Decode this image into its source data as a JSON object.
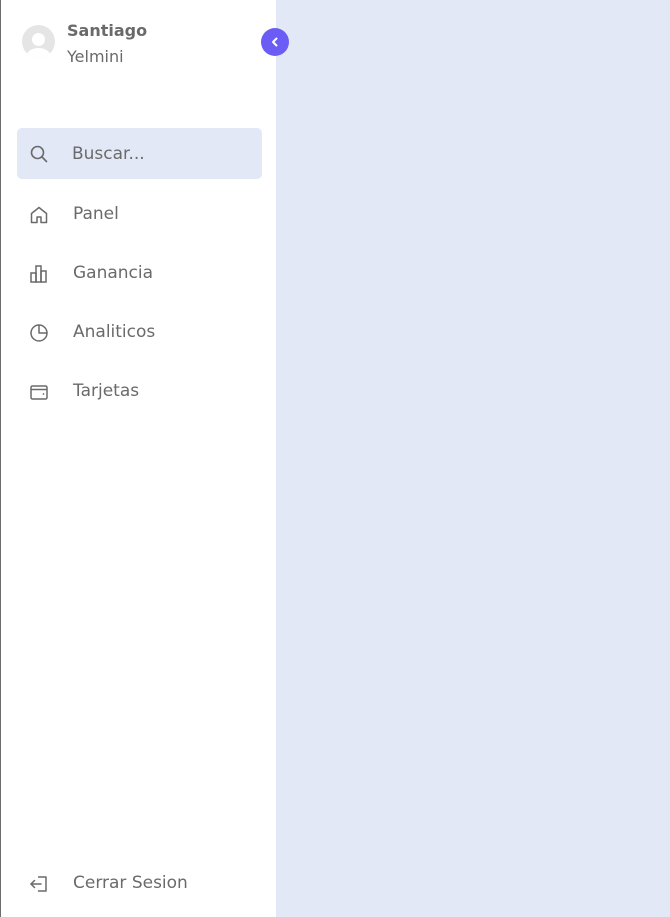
{
  "profile": {
    "first_name": "Santiago",
    "last_name": "Yelmini"
  },
  "search": {
    "placeholder": "Buscar..."
  },
  "nav": {
    "items": [
      {
        "label": "Panel",
        "icon": "home-icon"
      },
      {
        "label": "Ganancia",
        "icon": "bar-chart-icon"
      },
      {
        "label": "Analiticos",
        "icon": "pie-chart-icon"
      },
      {
        "label": "Tarjetas",
        "icon": "wallet-icon"
      }
    ]
  },
  "footer": {
    "logout_label": "Cerrar Sesion",
    "logout_icon": "logout-icon"
  },
  "colors": {
    "accent": "#6b5cf6",
    "background": "#e3e8f6",
    "sidebar": "#ffffff",
    "text": "#6a6a6a"
  }
}
